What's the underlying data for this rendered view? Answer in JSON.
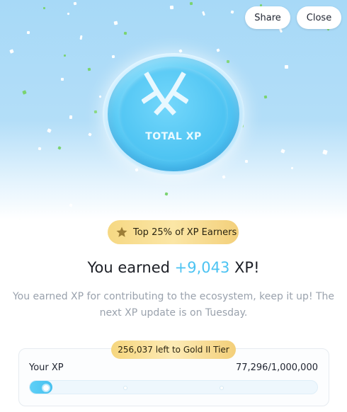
{
  "header": {
    "share_label": "Share",
    "close_label": "Close"
  },
  "coin": {
    "label": "TOTAL XP",
    "icon": "xp-logo-icon"
  },
  "badge": {
    "icon": "star-icon",
    "text": "Top 25% of XP Earners"
  },
  "headline": {
    "prefix": "You earned ",
    "amount": "+9,043",
    "suffix": " XP!"
  },
  "description": "You earned XP for contributing to the ecosystem, keep it up! The next XP update is on Tuesday.",
  "progress": {
    "tier_text": "256,037 left to Gold II Tier",
    "label": "Your XP",
    "value_text": "77,296/1,000,000",
    "current": 77296,
    "max": 1000000
  },
  "colors": {
    "accent": "#4cc3f2",
    "gold": "#f6d883",
    "hero_bg": "#a7d9f7"
  }
}
